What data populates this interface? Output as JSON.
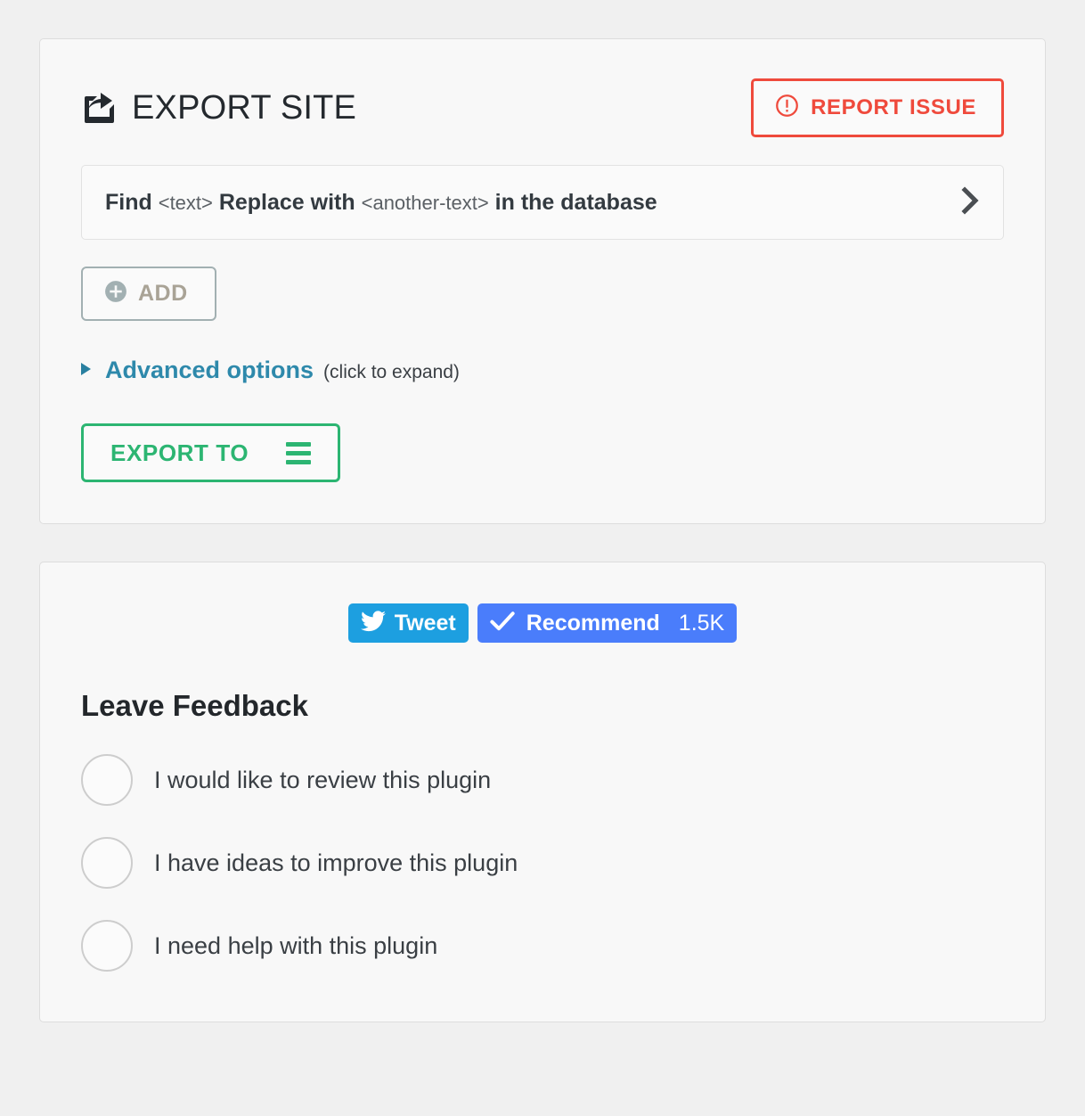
{
  "export_card": {
    "title": "EXPORT SITE",
    "title_icon": "share-export-icon",
    "report_button": {
      "label": "REPORT ISSUE",
      "icon": "exclamation-circle-icon",
      "color": "#ef4a3c"
    },
    "replace_row": {
      "find_label": "Find",
      "find_token": "<text>",
      "replace_label": "Replace with",
      "replace_token": "<another-text>",
      "suffix_label": "in the database",
      "chevron_icon": "chevron-right-icon"
    },
    "add_button": {
      "label": "ADD",
      "icon": "plus-circle-icon",
      "color": "#a2b0b2"
    },
    "advanced": {
      "link_label": "Advanced options",
      "hint_label": "(click to expand)",
      "marker_icon": "triangle-right-icon",
      "color": "#2e89ab"
    },
    "export_button": {
      "label": "EXPORT TO",
      "icon": "hamburger-menu-icon",
      "color": "#2cb572"
    }
  },
  "feedback_card": {
    "social": {
      "tweet": {
        "label": "Tweet",
        "icon": "twitter-bird-icon",
        "color": "#1d9fe0"
      },
      "recommend": {
        "label": "Recommend",
        "count": "1.5K",
        "icon": "check-icon",
        "color": "#4a7dfb"
      }
    },
    "section_title": "Leave Feedback",
    "options": [
      {
        "label": "I would like to review this plugin"
      },
      {
        "label": "I have ideas to improve this plugin"
      },
      {
        "label": "I need help with this plugin"
      }
    ]
  }
}
